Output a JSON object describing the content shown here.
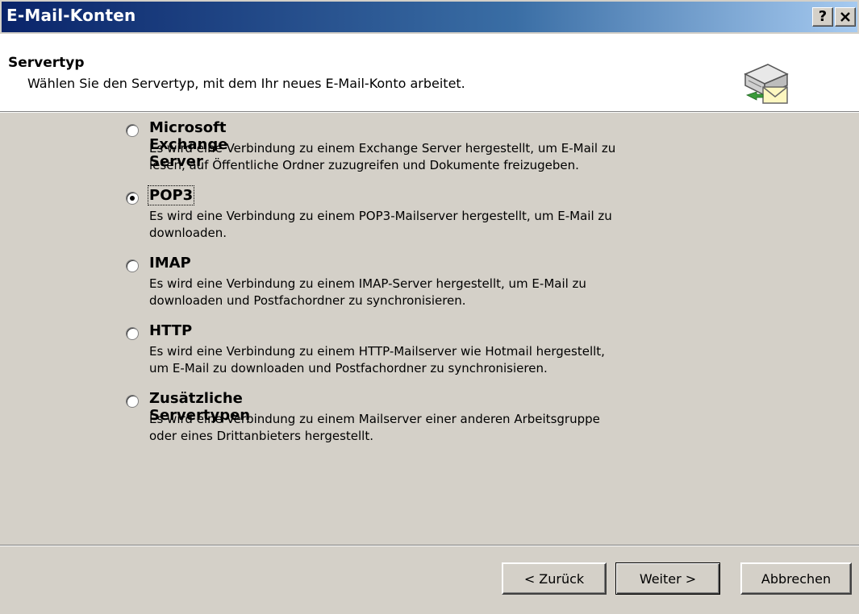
{
  "window": {
    "title": "E-Mail-Konten",
    "help_label": "?",
    "close_label": "×"
  },
  "header": {
    "title": "Servertyp",
    "subtitle": "Wählen Sie den Servertyp, mit dem Ihr neues E-Mail-Konto arbeitet.",
    "icon": "mail-server-icon"
  },
  "options": [
    {
      "label": "Microsoft Exchange Server",
      "description_line1": "Es wird eine Verbindung zu einem Exchange Server hergestellt, um E-Mail zu",
      "description_line2": "lesen, auf Öffentliche Ordner zuzugreifen und Dokumente freizugeben.",
      "selected": false
    },
    {
      "label": "POP3",
      "description_line1": "Es wird eine Verbindung zu einem POP3-Mailserver hergestellt, um E-Mail zu",
      "description_line2": "downloaden.",
      "selected": true
    },
    {
      "label": "IMAP",
      "description_line1": "Es wird eine Verbindung zu einem IMAP-Server hergestellt, um E-Mail zu",
      "description_line2": "downloaden und Postfachordner zu synchronisieren.",
      "selected": false
    },
    {
      "label": "HTTP",
      "description_line1": "Es wird eine Verbindung zu einem HTTP-Mailserver wie Hotmail hergestellt,",
      "description_line2": "um E-Mail zu downloaden und Postfachordner zu synchronisieren.",
      "selected": false
    },
    {
      "label": "Zusätzliche Servertypen",
      "description_line1": "Es wird eine Verbindung zu einem Mailserver einer anderen Arbeitsgruppe",
      "description_line2": "oder eines Drittanbieters hergestellt.",
      "selected": false
    }
  ],
  "buttons": {
    "back": "< Zurück",
    "next": "Weiter >",
    "cancel": "Abbrechen"
  }
}
